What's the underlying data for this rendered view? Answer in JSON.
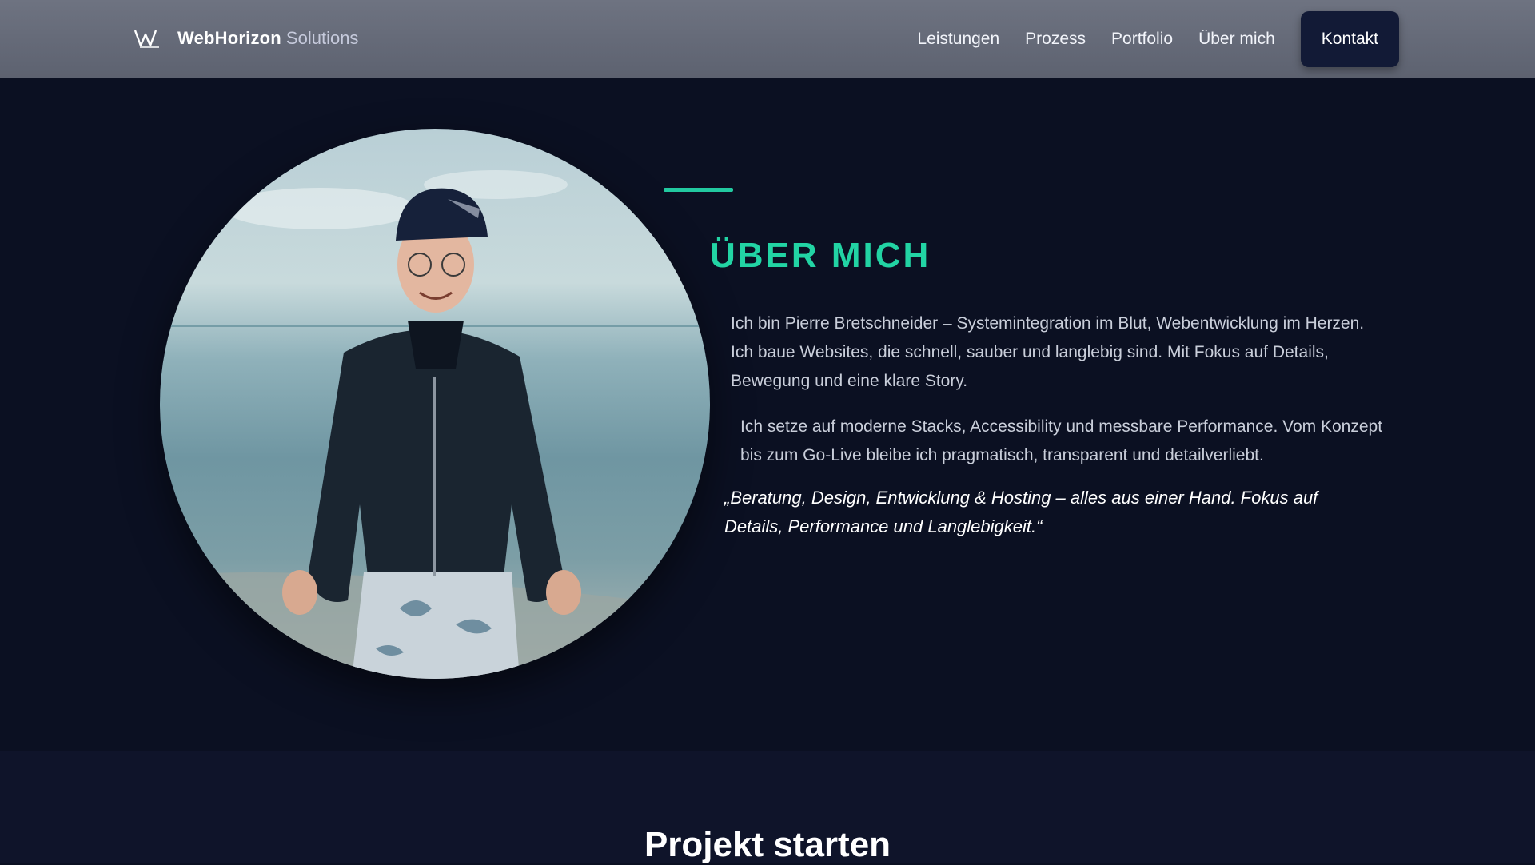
{
  "header": {
    "brand_name": "WebHorizon",
    "brand_sub": "Solutions",
    "nav": [
      "Leistungen",
      "Prozess",
      "Portfolio",
      "Über mich"
    ],
    "cta_label": "Kontakt"
  },
  "about": {
    "title": "ÜBER MICH",
    "paragraph1": "Ich bin Pierre Bretschneider – Systemintegration im Blut, Webentwicklung im Herzen. Ich baue Websites, die schnell, sauber und langlebig sind. Mit Fokus auf Details, Bewegung und eine klare Story.",
    "paragraph2": "Ich setze auf moderne Stacks, Accessibility und messbare Performance. Vom Konzept bis zum Go-Live bleibe ich pragmatisch, transparent und detailverliebt.",
    "quote": "„Beratung, Design, Entwicklung & Hosting – alles aus einer Hand. Fokus auf Details, Performance und Langlebigkeit.“"
  },
  "project": {
    "title": "Projekt starten"
  },
  "colors": {
    "accent": "#22d4a4",
    "background": "#0b1022",
    "header": "#626775",
    "button": "#121a36"
  }
}
